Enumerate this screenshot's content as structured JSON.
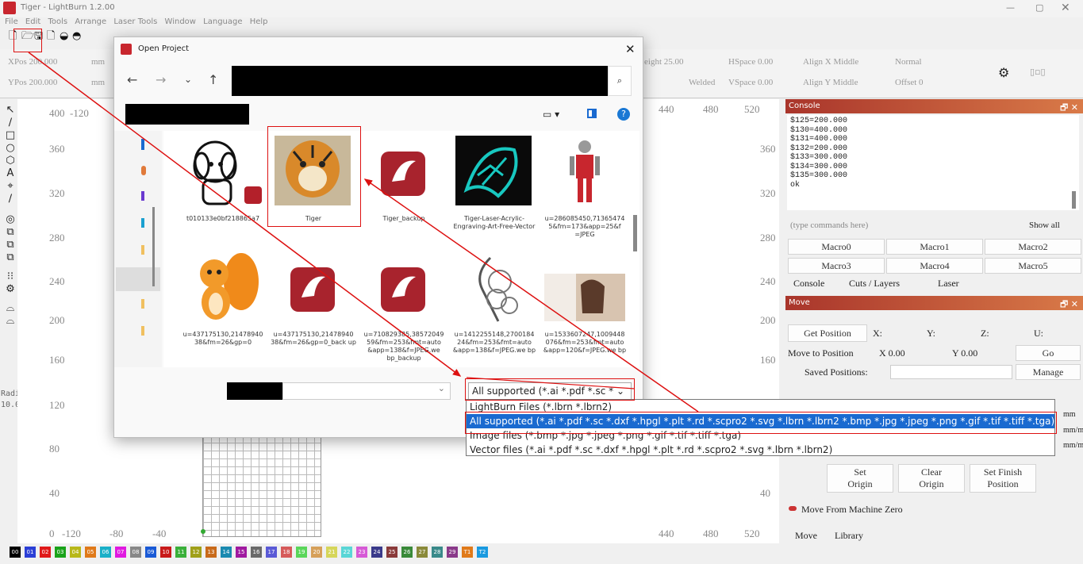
{
  "window": {
    "title": "Tiger - LightBurn 1.2.00",
    "min": "—",
    "max": "▢",
    "close": "✕"
  },
  "menu": [
    "File",
    "Edit",
    "Tools",
    "Arrange",
    "Laser Tools",
    "Window",
    "Language",
    "Help"
  ],
  "propbar": {
    "xpos": "XPos 200.000",
    "ypos": "YPos 200.000",
    "unit": "mm",
    "height": "eight 25.00",
    "hspace": "HSpace 0.00",
    "welded": "Welded",
    "vspace": "VSpace 0.00",
    "alignx": "Align X Middle",
    "aligny": "Align Y Middle",
    "normal": "Normal",
    "offset": "Offset 0"
  },
  "lefttools": {
    "radius_label": "Radius:",
    "radius_value": "10.0"
  },
  "canvas": {
    "vlabels": [
      "400",
      "360",
      "320",
      "280",
      "240",
      "200",
      "160",
      "120",
      "80",
      "40",
      "0"
    ],
    "hlabels": [
      "-120",
      "-80",
      "-40",
      "0",
      "40",
      "80",
      "120",
      "160",
      "200",
      "240",
      "280",
      "320",
      "360",
      "400",
      "440",
      "480",
      "520"
    ],
    "top_labels": [
      "-120",
      "440",
      "480",
      "520",
      "400"
    ]
  },
  "console": {
    "title": "Console",
    "lines": [
      "$125=200.000",
      "$130=400.000",
      "$131=400.000",
      "$132=200.000",
      "$133=300.000",
      "$134=300.000",
      "$135=300.000",
      "ok"
    ],
    "input_placeholder": "(type commands here)",
    "show_all": "Show all",
    "macros": [
      "Macro0",
      "Macro1",
      "Macro2",
      "Macro3",
      "Macro4",
      "Macro5"
    ],
    "tabs": [
      "Console",
      "Cuts / Layers",
      "Laser"
    ]
  },
  "move": {
    "title": "Move",
    "get_position": "Get Position",
    "x": "X:",
    "y": "Y:",
    "z": "Z:",
    "u": "U:",
    "move_to": "Move to Position",
    "xval": "X 0.00",
    "yval": "Y 0.00",
    "go": "Go",
    "saved": "Saved Positions:",
    "manage": "Manage",
    "set_origin": "Set\nOrigin",
    "clear_origin": "Clear\nOrigin",
    "set_finish": "Set Finish\nPosition",
    "move_from_zero": "Move From Machine Zero",
    "tabs": [
      "Move",
      "Library"
    ],
    "units": [
      "mm",
      "mm/m",
      "mm/m"
    ]
  },
  "dialog": {
    "title": "Open Project",
    "files": [
      {
        "name": "t010133e0bf218865a7"
      },
      {
        "name": "Tiger"
      },
      {
        "name": "Tiger_backup"
      },
      {
        "name": "Tiger-Laser-Acrylic-Engraving-Art-Free-Vector"
      },
      {
        "name": "u=286085450,71365474 5&fm=173&app=25&f =JPEG"
      },
      {
        "name": "u=437175130,21478940 38&fm=26&gp=0"
      },
      {
        "name": "u=437175130,21478940 38&fm=26&gp=0_back up"
      },
      {
        "name": "u=710829385,38572049 59&fm=253&fmt=auto &app=138&f=JPEG.we bp_backup"
      },
      {
        "name": "u=1412255148,2700184 24&fm=253&fmt=auto &app=138&f=JPEG.we bp"
      },
      {
        "name": "u=1533607247,1009448 076&fm=253&fmt=auto &app=120&f=JPEG.we bp"
      }
    ],
    "filter_selected": "All supported (*.ai *.pdf *.sc *"
  },
  "filetypes": [
    "LightBurn Files (*.lbrn *.lbrn2)",
    "All supported (*.ai *.pdf *.sc *.dxf *.hpgl *.plt *.rd *.scpro2 *.svg *.lbrn *.lbrn2 *.bmp *.jpg *.jpeg *.png *.gif *.tif *.tiff *.tga)",
    "Image files (*.bmp *.jpg *.jpeg *.png *.gif *.tif *.tiff *.tga)",
    "Vector files (*.ai *.pdf *.sc *.dxf *.hpgl *.plt *.rd *.scpro2 *.svg *.lbrn *.lbrn2)"
  ],
  "palette": [
    {
      "label": "00",
      "color": "#000000"
    },
    {
      "label": "01",
      "color": "#2b3fd6"
    },
    {
      "label": "02",
      "color": "#e01a1a"
    },
    {
      "label": "03",
      "color": "#1aa31a"
    },
    {
      "label": "04",
      "color": "#b8b81a"
    },
    {
      "label": "05",
      "color": "#e07a1a"
    },
    {
      "label": "06",
      "color": "#1ab0c8"
    },
    {
      "label": "07",
      "color": "#e01ae0"
    },
    {
      "label": "08",
      "color": "#888888"
    },
    {
      "label": "09",
      "color": "#1a5ad6"
    },
    {
      "label": "10",
      "color": "#c81a1a"
    },
    {
      "label": "11",
      "color": "#3ab03a"
    },
    {
      "label": "12",
      "color": "#a0a01a"
    },
    {
      "label": "13",
      "color": "#c86a1a"
    },
    {
      "label": "14",
      "color": "#1a8ab0"
    },
    {
      "label": "15",
      "color": "#a01aa0"
    },
    {
      "label": "16",
      "color": "#6a6a6a"
    },
    {
      "label": "17",
      "color": "#5a5ad6"
    },
    {
      "label": "18",
      "color": "#d65a5a"
    },
    {
      "label": "19",
      "color": "#5ad65a"
    },
    {
      "label": "20",
      "color": "#d6a05a"
    },
    {
      "label": "21",
      "color": "#d6d65a"
    },
    {
      "label": "22",
      "color": "#5ad6d6"
    },
    {
      "label": "23",
      "color": "#d65ad6"
    },
    {
      "label": "24",
      "color": "#3a3a8a"
    },
    {
      "label": "25",
      "color": "#8a3a3a"
    },
    {
      "label": "26",
      "color": "#3a8a3a"
    },
    {
      "label": "27",
      "color": "#8a8a3a"
    },
    {
      "label": "28",
      "color": "#3a8a8a"
    },
    {
      "label": "29",
      "color": "#8a3a8a"
    },
    {
      "label": "T1",
      "color": "#e07a1a"
    },
    {
      "label": "T2",
      "color": "#1a9ae0"
    }
  ]
}
